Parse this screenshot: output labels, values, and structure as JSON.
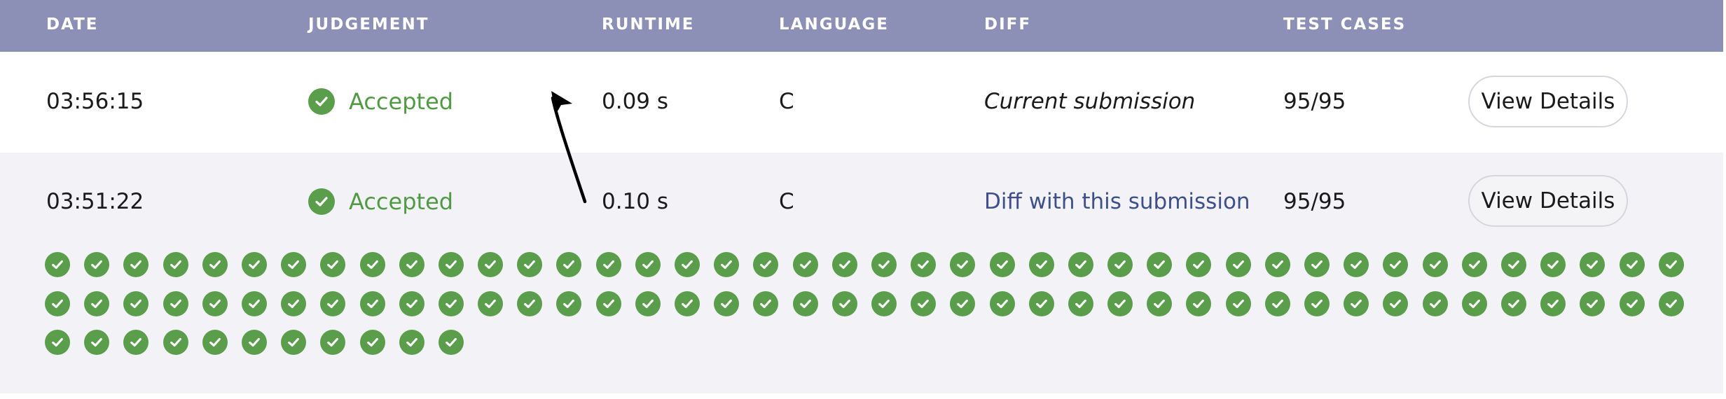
{
  "columns": {
    "date": "DATE",
    "judgement": "JUDGEMENT",
    "runtime": "RUNTIME",
    "language": "LANGUAGE",
    "diff": "DIFF",
    "test_cases": "TEST CASES"
  },
  "submissions": [
    {
      "date": "03:56:15",
      "judgement": "Accepted",
      "runtime": "0.09 s",
      "language": "C",
      "diff": "Current submission",
      "test_cases": "95/95",
      "button": "View Details"
    },
    {
      "date": "03:51:22",
      "judgement": "Accepted",
      "runtime": "0.10 s",
      "language": "C",
      "diff": "Diff with this submission",
      "test_cases": "95/95",
      "button": "View Details"
    }
  ],
  "test_results": {
    "total": 95,
    "passed": 95,
    "icon": "check-circle-icon"
  },
  "colors": {
    "header_bg": "#8c8fb6",
    "accepted": "#4f9a43",
    "check_fill": "#5a9e4b",
    "link": "#3f4f8a",
    "alt_row_bg": "#f2f2f7"
  }
}
